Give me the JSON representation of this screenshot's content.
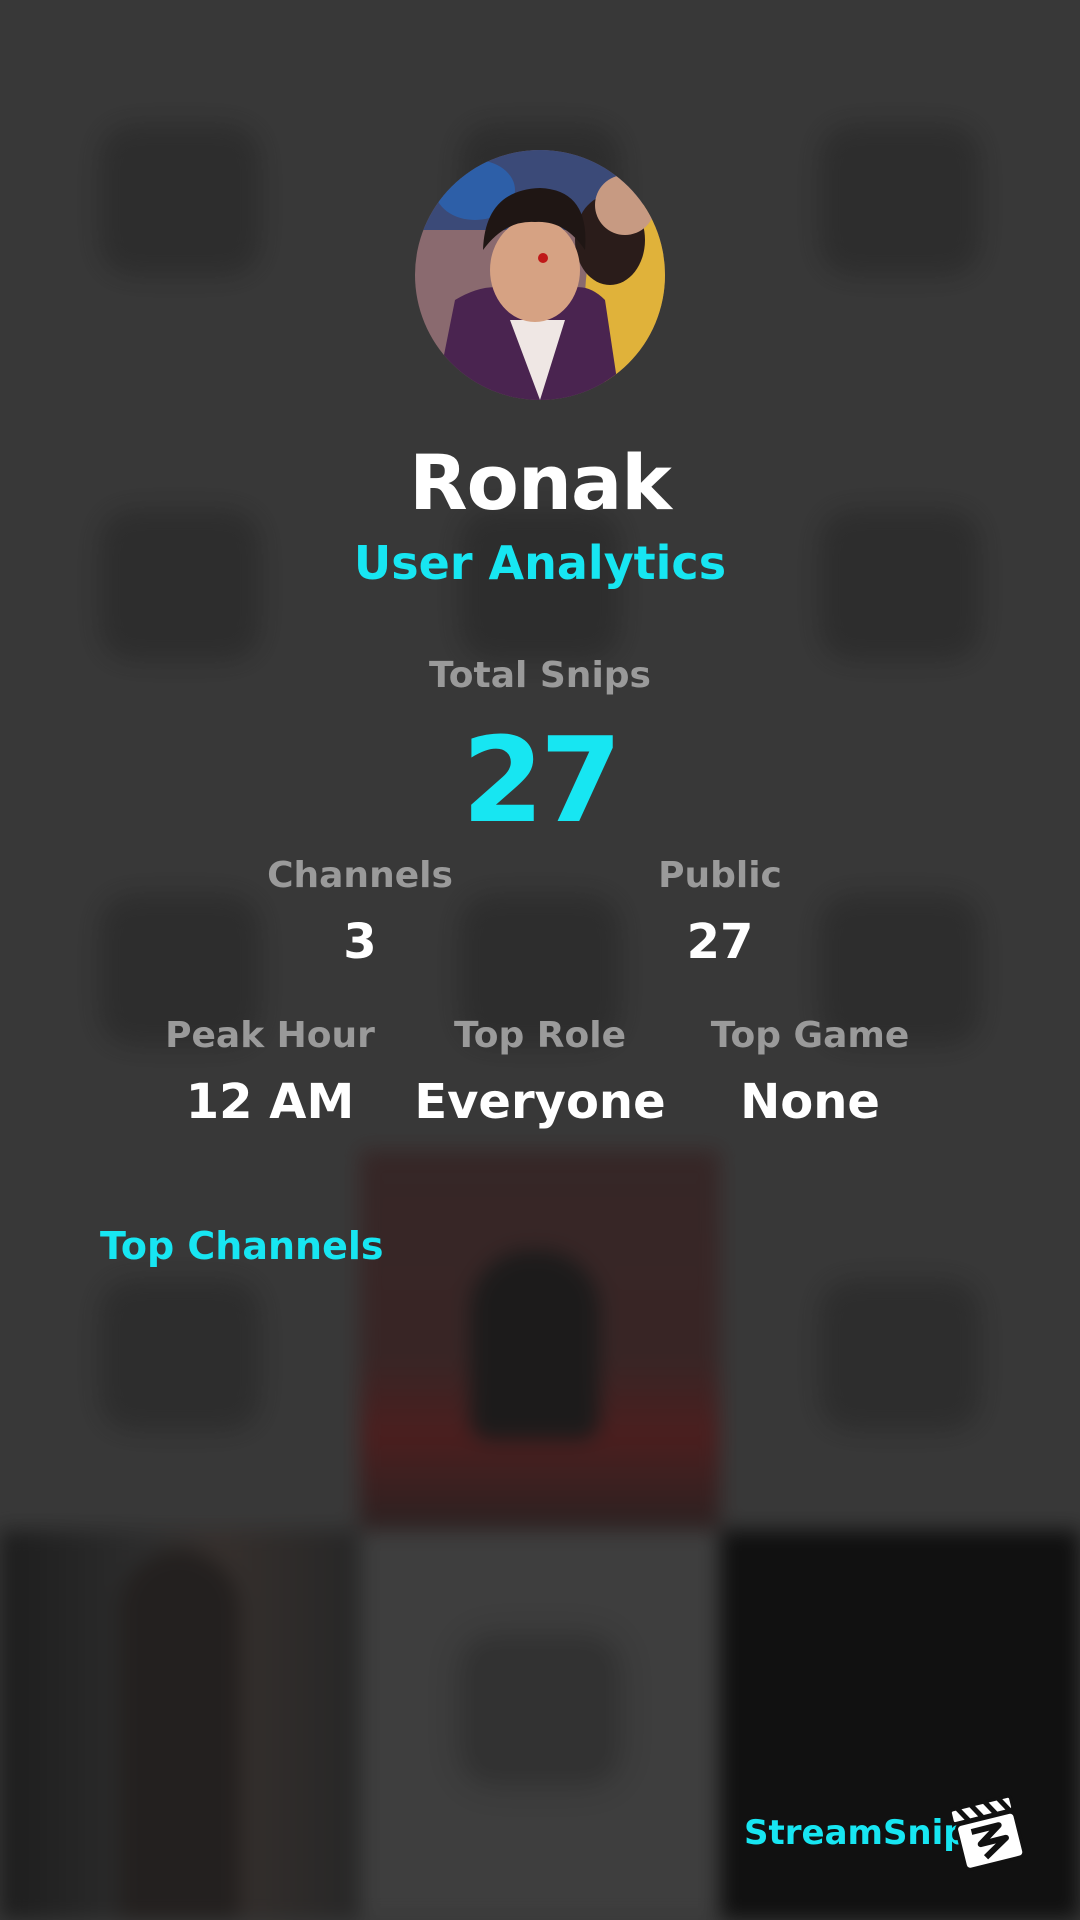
{
  "profile": {
    "username": "Ronak",
    "subtitle": "User Analytics"
  },
  "stats": {
    "total_snips_label": "Total Snips",
    "total_snips_value": "27",
    "channels_label": "Channels",
    "channels_value": "3",
    "public_label": "Public",
    "public_value": "27",
    "peak_hour_label": "Peak Hour",
    "peak_hour_value": "12 AM",
    "top_role_label": "Top Role",
    "top_role_value": "Everyone",
    "top_game_label": "Top Game",
    "top_game_value": "None"
  },
  "sections": {
    "top_channels_title": "Top Channels"
  },
  "brand": {
    "name": "StreamSnip",
    "logo_icon": "clapperboard-logo-icon"
  },
  "colors": {
    "accent": "#17e6f2",
    "text_primary": "#ffffff",
    "text_muted": "#9a9a9a",
    "background": "#3d3d3d"
  }
}
